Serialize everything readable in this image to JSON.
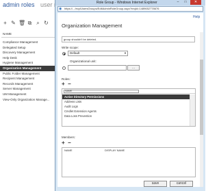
{
  "admin": {
    "tabs": [
      "admin roles",
      "user roles"
    ],
    "toolbar_icons": [
      "plus-icon",
      "edit-icon",
      "delete-icon",
      "copy-icon",
      "search-icon",
      "refresh-icon"
    ],
    "column_header": "NAME",
    "roles": [
      "Compliance Management",
      "Delegated Setup",
      "Discovery Management",
      "Help Desk",
      "Hygiene Management",
      "Organization Management",
      "Public Folder Management",
      "Recipient Management",
      "Records Management",
      "Server Management",
      "UM Management",
      "View-Only Organization Manage..."
    ],
    "selected_index": 5
  },
  "dialog": {
    "window_title": "Role Group - Windows Internet Explorer",
    "address": "https://.../ecp/UsersGroups/EditAdminRoleGroup.aspx?reqId=1489652778676",
    "help": "Help",
    "heading": "Organization Management",
    "description_tail": "group shouldn't be deleted.",
    "write_scope_label": "Write scope:",
    "write_scope_value": "Default",
    "ou_label": "Organizational unit:",
    "browse_label": "...",
    "roles_label": "Roles:",
    "roles_column": "NAME",
    "roles": [
      "Active Directory Permissions",
      "Address Lists",
      "Audit Logs",
      "Cmdlet Extension Agents",
      "Data Loss Prevention"
    ],
    "roles_selected_index": 0,
    "members_label": "Members:",
    "members_columns": [
      "NAME",
      "DISPLAY NAME"
    ],
    "save_label": "save",
    "cancel_label": "cancel"
  }
}
